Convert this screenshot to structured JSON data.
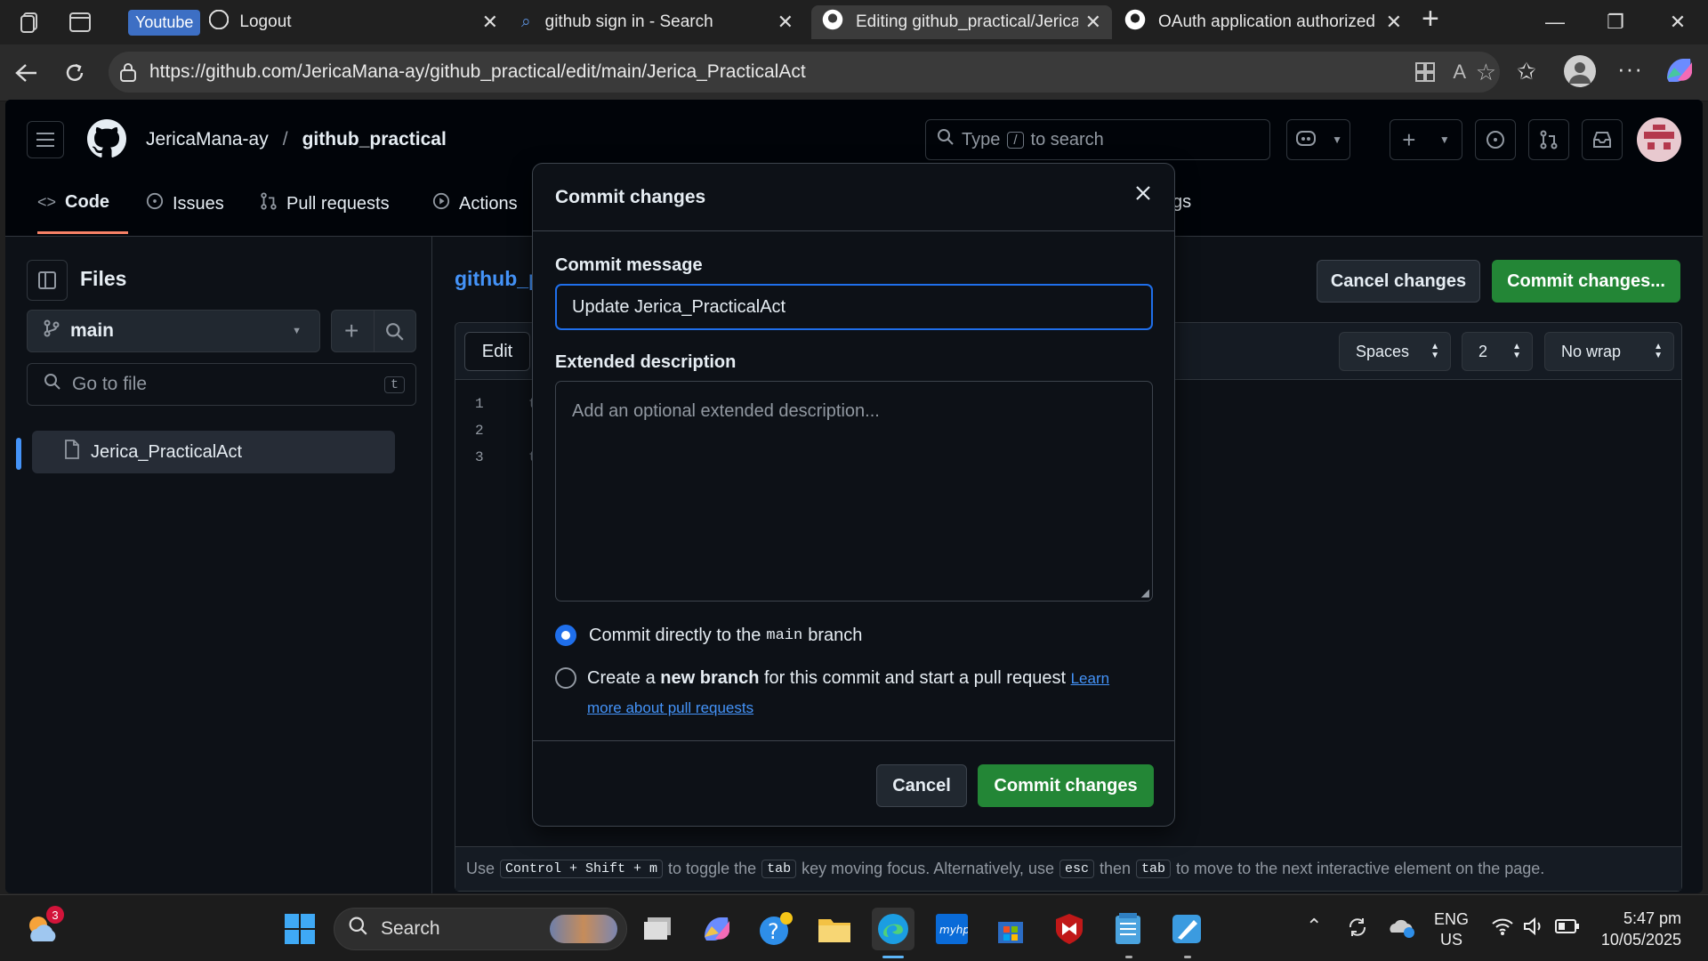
{
  "browser": {
    "tabs": [
      {
        "label": "Logout",
        "badge": "Youtube"
      },
      {
        "label": "github sign in - Search"
      },
      {
        "label": "Editing github_practical/Jerica_"
      },
      {
        "label": "OAuth application authorized"
      }
    ],
    "url": "https://github.com/JericaMana-ay/github_practical/edit/main/Jerica_PracticalAct"
  },
  "github": {
    "owner": "JericaMana-ay",
    "separator": "/",
    "repo": "github_practical",
    "search_placeholder_pre": "Type",
    "search_key": "/",
    "search_placeholder_post": "to search",
    "nav": {
      "code": "Code",
      "issues": "Issues",
      "pulls": "Pull requests",
      "actions": "Actions",
      "settings_tail": "gs"
    },
    "sidebar": {
      "title": "Files",
      "branch": "main",
      "goto_placeholder": "Go to file",
      "goto_key": "t",
      "file": "Jerica_PracticalAct"
    },
    "editor": {
      "breadcrumb": "github_p",
      "cancel": "Cancel changes",
      "commit": "Commit changes...",
      "edit_tab": "Edit",
      "indent_mode": "Spaces",
      "indent_size": "2",
      "wrap": "No wrap",
      "line_numbers": [
        "1",
        "2",
        "3"
      ],
      "line_chars": [
        "t",
        "",
        "t"
      ],
      "footer": {
        "use": "Use",
        "k1": "Control + Shift + m",
        "t1": "to toggle the",
        "k2": "tab",
        "t2": "key moving focus. Alternatively, use",
        "k3": "esc",
        "t3": "then",
        "k4": "tab",
        "t4": "to move to the next interactive element on the page."
      }
    }
  },
  "modal": {
    "title": "Commit changes",
    "message_label": "Commit message",
    "message_value": "Update Jerica_PracticalAct",
    "desc_label": "Extended description",
    "desc_placeholder": "Add an optional extended description...",
    "opt1_pre": "Commit directly to the",
    "opt1_code": "main",
    "opt1_post": "branch",
    "opt2_pre": "Create a",
    "opt2_bold": "new branch",
    "opt2_post": "for this commit and start a pull request",
    "opt2_link_a": "Learn",
    "opt2_link_b": "more about pull requests",
    "cancel": "Cancel",
    "commit": "Commit changes"
  },
  "taskbar": {
    "search": "Search",
    "weather_badge": "3",
    "lang1": "ENG",
    "lang2": "US",
    "time": "5:47 pm",
    "date": "10/05/2025"
  },
  "colors": {
    "accent_green": "#238636",
    "link_blue": "#4493f8",
    "focus_blue": "#1f6feb"
  }
}
